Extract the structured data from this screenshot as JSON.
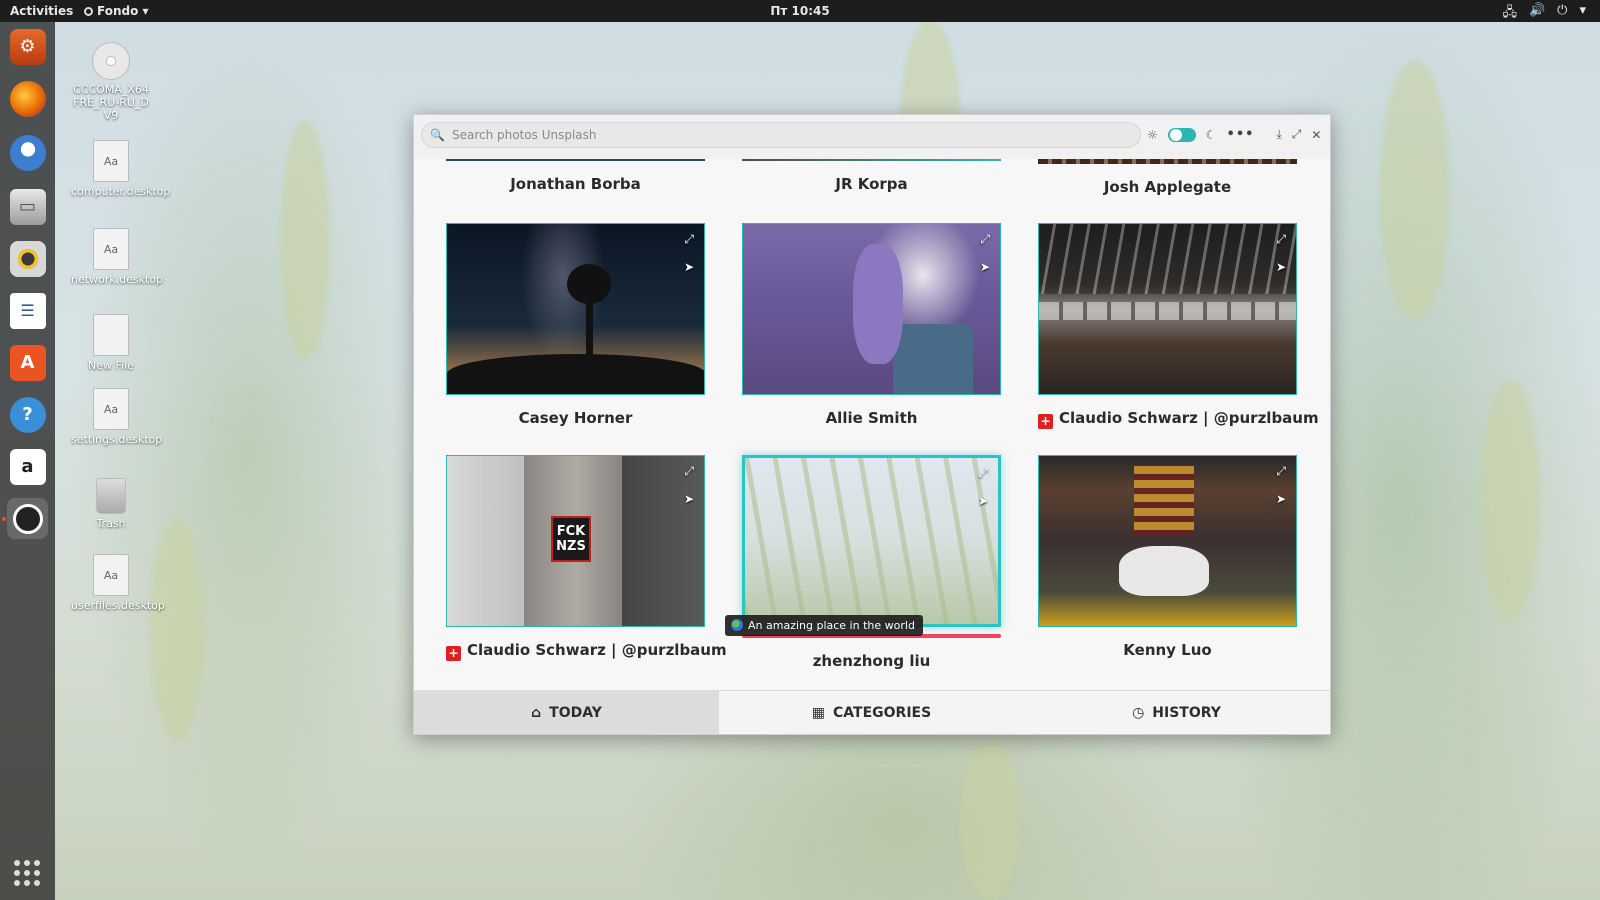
{
  "topbar": {
    "activities": "Activities",
    "app_name": "Fondo ▾",
    "clock": "Пт 10:45"
  },
  "desktop_icons": [
    {
      "label": "CCCOMA_X64FRE_RU-RU_DV9"
    },
    {
      "label": "computer.desktop"
    },
    {
      "label": "network.desktop"
    },
    {
      "label": "New File"
    },
    {
      "label": "settings.desktop"
    },
    {
      "label": "Trash"
    },
    {
      "label": "userfiles.desktop"
    }
  ],
  "search": {
    "placeholder": "Search photos Unsplash"
  },
  "photos": {
    "top_row": [
      "Jonathan Borba",
      "JR Korpa",
      "Josh Applegate"
    ],
    "row2": [
      "Casey Horner",
      "Allie Smith",
      "Claudio Schwarz | @purzlbaum"
    ],
    "row3": [
      "Claudio Schwarz | @purzlbaum",
      "zhenzhong liu",
      "Kenny Luo"
    ]
  },
  "tooltip": "An amazing place in the world",
  "tabs": {
    "today": "TODAY",
    "categories": "CATEGORIES",
    "history": "HISTORY"
  }
}
